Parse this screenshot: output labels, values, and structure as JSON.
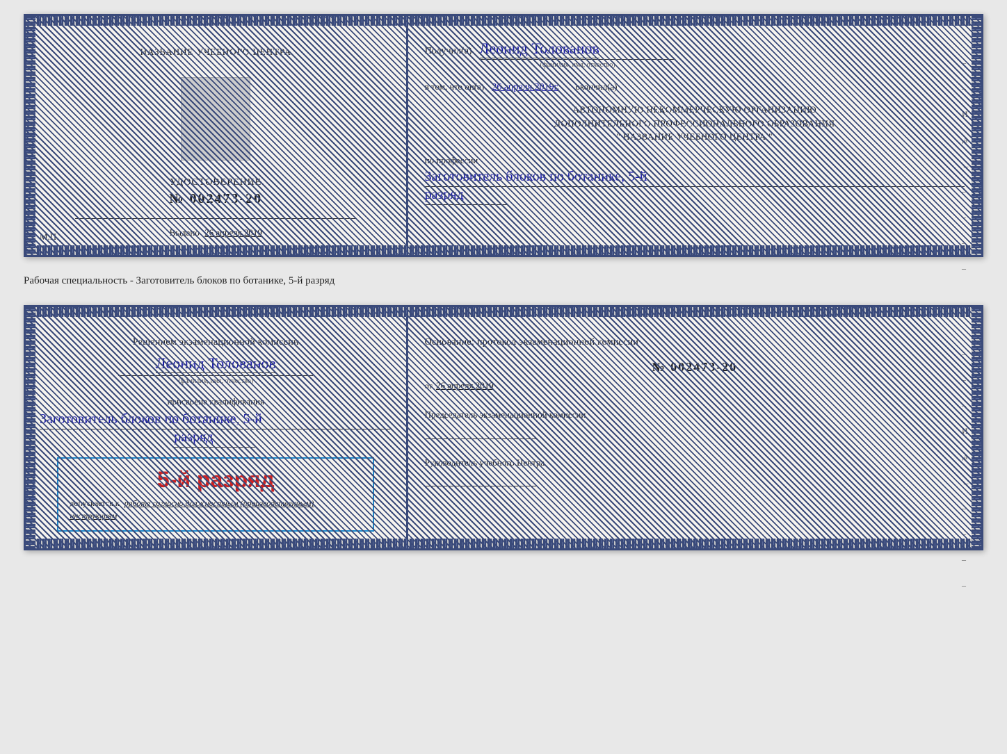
{
  "card1": {
    "left": {
      "center_title": "НАЗВАНИЕ УЧЕБНОГО ЦЕНТРА",
      "cert_label": "УДОСТОВЕРЕНИЕ",
      "cert_number": "№ 002473-20",
      "issued_text": "Выдано",
      "issued_date": "26 апреля 2019",
      "mp_label": "М.П."
    },
    "right": {
      "received_prefix": "Получил(а)",
      "recipient_name": "Леонид Толованов",
      "fio_label": "(фамилия, имя, отчество)",
      "confirm_prefix": "в том, что он(а)",
      "confirm_date": "26 апреля 2019г.",
      "confirm_suffix": "окончил(а)",
      "org_line1": "АВТОНОМНУЮ НЕКОММЕРЧЕСКУЮ ОРГАНИЗАЦИЮ",
      "org_line2": "ДОПОЛНИТЕЛЬНОГО ПРОФЕССИОНАЛЬНОГО ОБРАЗОВАНИЯ",
      "org_line3": "\"  НАЗВАНИЕ УЧЕБНОГО ЦЕНТРА  \"",
      "profession_label": "по профессии",
      "profession_name": "Заготовитель блоков по ботанике, 5-й",
      "profession_rank": "разряд"
    }
  },
  "separator": {
    "text": "Рабочая специальность - Заготовитель блоков по ботанике, 5-й разряд"
  },
  "card2": {
    "left": {
      "decision_text": "Решением экзаменационной комиссии",
      "recipient_name": "Леонид Толованов",
      "fio_label": "(фамилия, имя, отчество)",
      "qual_assigned": "присвоена квалификация",
      "qual_name": "Заготовитель блоков по ботанике, 5-й",
      "qual_rank": "разряд",
      "stamp_rank": "5-й разряд",
      "allowed_text": "допускается к",
      "allowed_italic": "работе согласно должностным (производственным) инструкциям"
    },
    "right": {
      "basis_text": "Основание: протокол экзаменационной комиссии",
      "protocol_number": "№ 002473-20",
      "from_prefix": "от",
      "from_date": "26 апреля 2019",
      "chairman_label": "Председатель экзаменационной комиссии",
      "director_label": "Руководитель учебного Центра"
    }
  }
}
